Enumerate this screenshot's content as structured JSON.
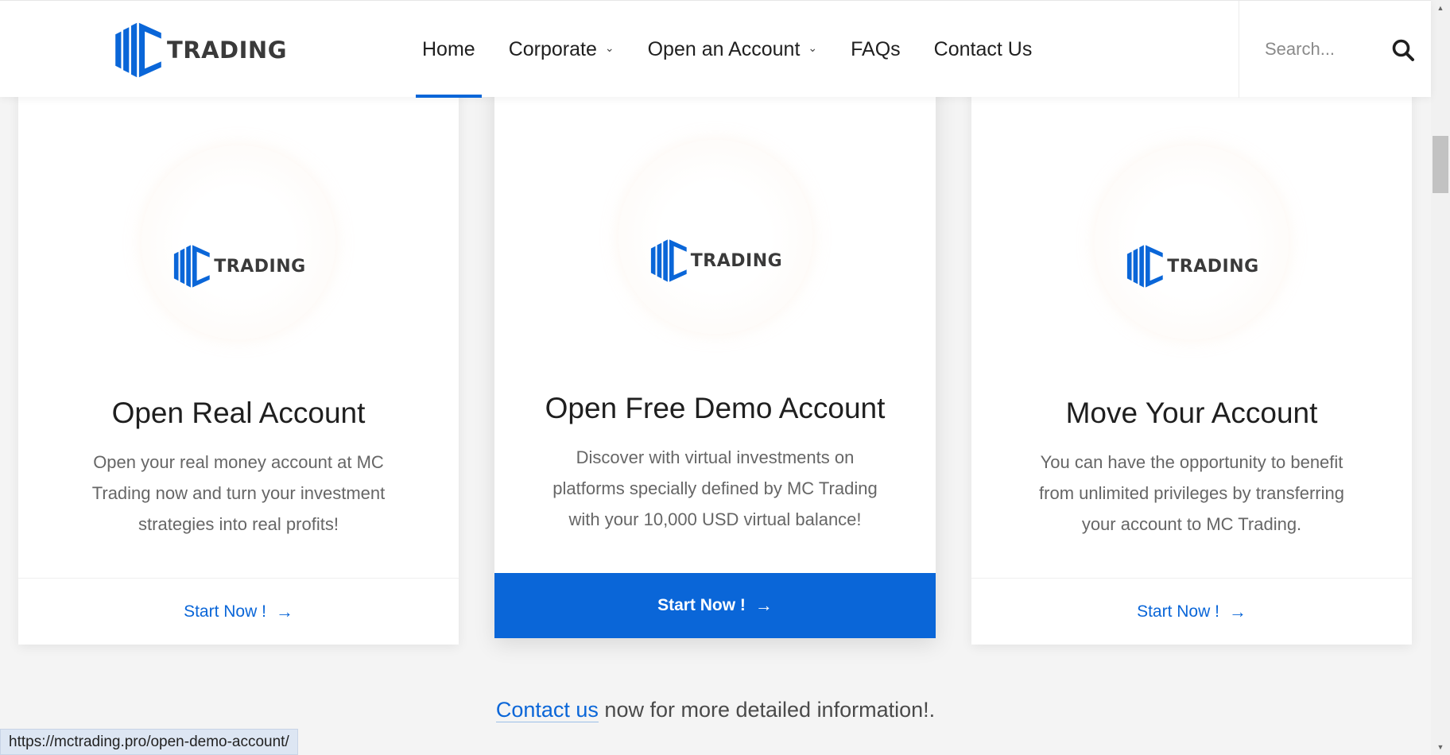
{
  "brand": {
    "wordmark": "TRADING",
    "colors": {
      "primary": "#0a66d8",
      "dark": "#3a3a3a"
    }
  },
  "nav": {
    "items": [
      {
        "label": "Home",
        "active": true
      },
      {
        "label": "Corporate",
        "dropdown": true
      },
      {
        "label": "Open an Account",
        "dropdown": true
      },
      {
        "label": "FAQs"
      },
      {
        "label": "Contact Us"
      }
    ],
    "chevron": "⌄"
  },
  "search": {
    "placeholder": "Search...",
    "icon": "search-icon"
  },
  "cards": [
    {
      "title": "Open Real Account",
      "text": "Open your real money account at MC Trading now and turn your investment strategies into real profits!",
      "cta": "Start Now !",
      "arrow": "→"
    },
    {
      "title": "Open Free Demo Account",
      "text": "Discover with virtual investments on platforms specially defined by MC Trading with your 10,000 USD virtual balance!",
      "cta": "Start Now !",
      "arrow": "→",
      "highlighted": true
    },
    {
      "title": "Move Your Account",
      "text": "You can have the opportunity to benefit from unlimited privileges by transferring your account to MC Trading.",
      "cta": "Start Now !",
      "arrow": "→"
    }
  ],
  "contact": {
    "link_text": "Contact us",
    "rest_text": " now for more detailed information!."
  },
  "status_url": "https://mctrading.pro/open-demo-account/",
  "scrollbar": {
    "up": "▲",
    "down": "▼"
  }
}
